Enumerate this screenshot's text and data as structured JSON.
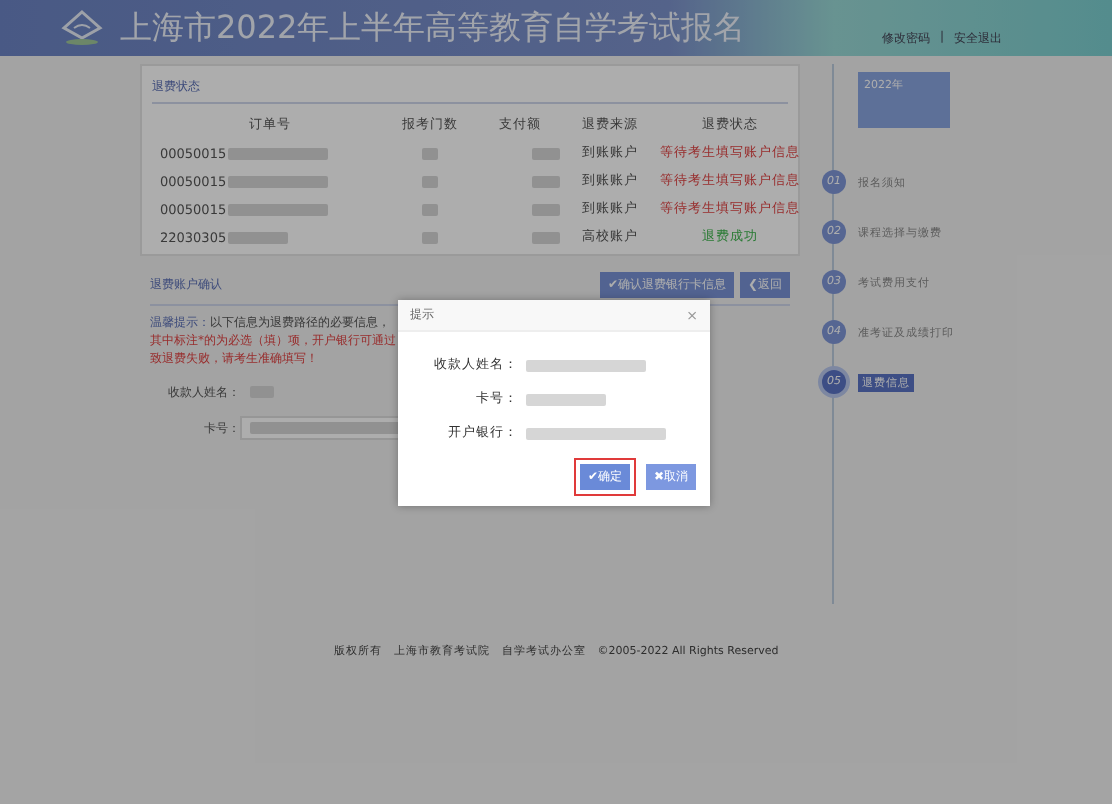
{
  "header": {
    "title": "上海市2022年上半年高等教育自学考试报名",
    "links": [
      "修改密码",
      "安全退出"
    ],
    "separator": "|"
  },
  "refund_status": {
    "title": "退费状态",
    "columns": [
      "订单号",
      "报考门数",
      "支付额",
      "退费来源",
      "退费状态"
    ],
    "rows": [
      {
        "order": "00050015",
        "source": "到账账户",
        "status": "等待考生填写账户信息",
        "kind": "waiting"
      },
      {
        "order": "00050015",
        "source": "到账账户",
        "status": "等待考生填写账户信息",
        "kind": "waiting"
      },
      {
        "order": "00050015",
        "source": "到账账户",
        "status": "等待考生填写账户信息",
        "kind": "waiting"
      },
      {
        "order": "22030305",
        "source": "高校账户",
        "status": "退费成功",
        "kind": "success"
      }
    ]
  },
  "account": {
    "title": "退费账户确认",
    "buttons": [
      {
        "icon": "✔",
        "label": "确认退费银行卡信息"
      },
      {
        "icon": "❮",
        "label": "返回"
      }
    ],
    "notice_label": "温馨提示：",
    "notice": "以下信息为退费路径的必要信息，",
    "warning": "其中标注*的为必选（填）项，开户银行可通过",
    "warning_end": "致退费失败，请考生准确填写！",
    "fields": [
      {
        "label": "收款人姓名："
      },
      {
        "label": "卡号："
      }
    ]
  },
  "steps": {
    "bubble": "2022年",
    "items": [
      {
        "number": "01",
        "label": "报名须知",
        "selected": false
      },
      {
        "number": "02",
        "label": "课程选择与缴费",
        "selected": false
      },
      {
        "number": "03",
        "label": "考试费用支付",
        "selected": false
      },
      {
        "number": "04",
        "label": "准考证及成绩打印",
        "selected": false
      },
      {
        "number": "05",
        "label": "退费信息",
        "selected": true
      }
    ]
  },
  "footer": "版权所有　上海市教育考试院　自学考试办公室　©2005-2022 All Rights Reserved",
  "dialog": {
    "title": "提示",
    "close": "×",
    "fields": [
      {
        "label": "收款人姓名："
      },
      {
        "label": "卡号："
      },
      {
        "label": "开户银行："
      }
    ],
    "buttons": [
      {
        "icon": "✔",
        "label": "确定",
        "kind": "primary",
        "highlighted": true
      },
      {
        "icon": "✖",
        "label": "取消",
        "kind": "secondary",
        "highlighted": false
      }
    ]
  }
}
